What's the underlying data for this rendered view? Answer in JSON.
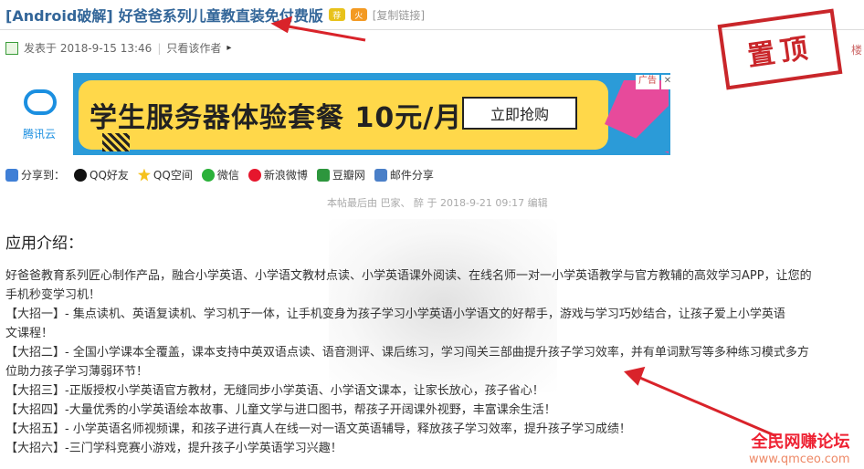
{
  "header": {
    "tag": "[Android破解]",
    "title": "好爸爸系列儿童教直装免付费版",
    "hot_badge": "荐",
    "fire_badge": "火",
    "copy_link": "[复制链接]"
  },
  "meta": {
    "posted": "发表于 2018-9-15 13:46",
    "sep": "|",
    "only_author": "只看该作者",
    "arrow": "▸"
  },
  "stamp": "置顶",
  "side_text": "楼",
  "ad": {
    "brand": "腾讯云",
    "headline": "学生服务器体验套餐  10元/月",
    "button": "立即抢购",
    "tag": "广告",
    "close": "✕"
  },
  "share": {
    "label": "分享到：",
    "items": [
      "QQ好友",
      "QQ空间",
      "微信",
      "新浪微博",
      "豆瓣网",
      "邮件分享"
    ]
  },
  "edit_note": "本帖最后由 巴家、 醉 于 2018-9-21 09:17 编辑",
  "section_title": "应用介绍：",
  "paragraphs": [
    "好爸爸教育系列匠心制作产品，融合小学英语、小学语文教材点读、小学英语课外阅读、在线名师一对一小学英语教学与官方教辅的高效学习APP，让您的",
    "手机秒变学习机！",
    "【大招一】- 集点读机、英语复读机、学习机于一体，让手机变身为孩子学习小学英语小学语文的好帮手，游戏与学习巧妙结合，让孩子爱上小学英语",
    "文课程！",
    "【大招二】- 全国小学课本全覆盖，课本支持中英双语点读、语音测评、课后练习，学习闯关三部曲提升孩子学习效率，并有单词默写等多种练习模式多方",
    "位助力孩子学习薄弱环节！",
    "【大招三】-正版授权小学英语官方教材，无缝同步小学英语、小学语文课本，让家长放心，孩子省心！",
    "【大招四】-大量优秀的小学英语绘本故事、儿童文学与进口图书，帮孩子开阔课外视野，丰富课余生活！",
    "【大招五】- 小学英语名师视频课，和孩子进行真人在线一对一语文英语辅导，释放孩子学习效率，提升孩子学习成绩！",
    "【大招六】-三门学科竞赛小游戏，提升孩子小学英语学习兴趣！"
  ],
  "watermark": {
    "title": "全民网赚论坛",
    "url": "www.qmceo.com"
  },
  "colors": {
    "title_blue": "#336699",
    "stamp_red": "#c9262a",
    "ad_yellow": "#ffd84a",
    "ad_blue": "#2b9bd8",
    "arrow_red": "#d9232a"
  }
}
